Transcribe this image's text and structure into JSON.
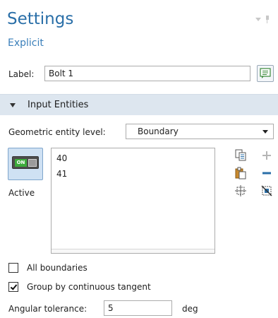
{
  "header": {
    "title": "Settings",
    "subtitle": "Explicit"
  },
  "label_field": {
    "label": "Label:",
    "value": "Bolt 1"
  },
  "section": {
    "title": "Input Entities"
  },
  "geometric_entity": {
    "label": "Geometric entity level:",
    "selected": "Boundary"
  },
  "active": {
    "toggle_text": "ON",
    "label": "Active"
  },
  "selection": {
    "items": [
      "40",
      "41"
    ]
  },
  "options": {
    "all_boundaries": {
      "label": "All boundaries",
      "checked": false
    },
    "group_by_tangent": {
      "label": "Group by continuous tangent",
      "checked": true
    }
  },
  "angular_tolerance": {
    "label": "Angular tolerance:",
    "value": "5",
    "unit": "deg"
  },
  "colors": {
    "title": "#2a6fa8",
    "section_bg": "#dde6ef",
    "toggle_on": "#3cab3c"
  }
}
